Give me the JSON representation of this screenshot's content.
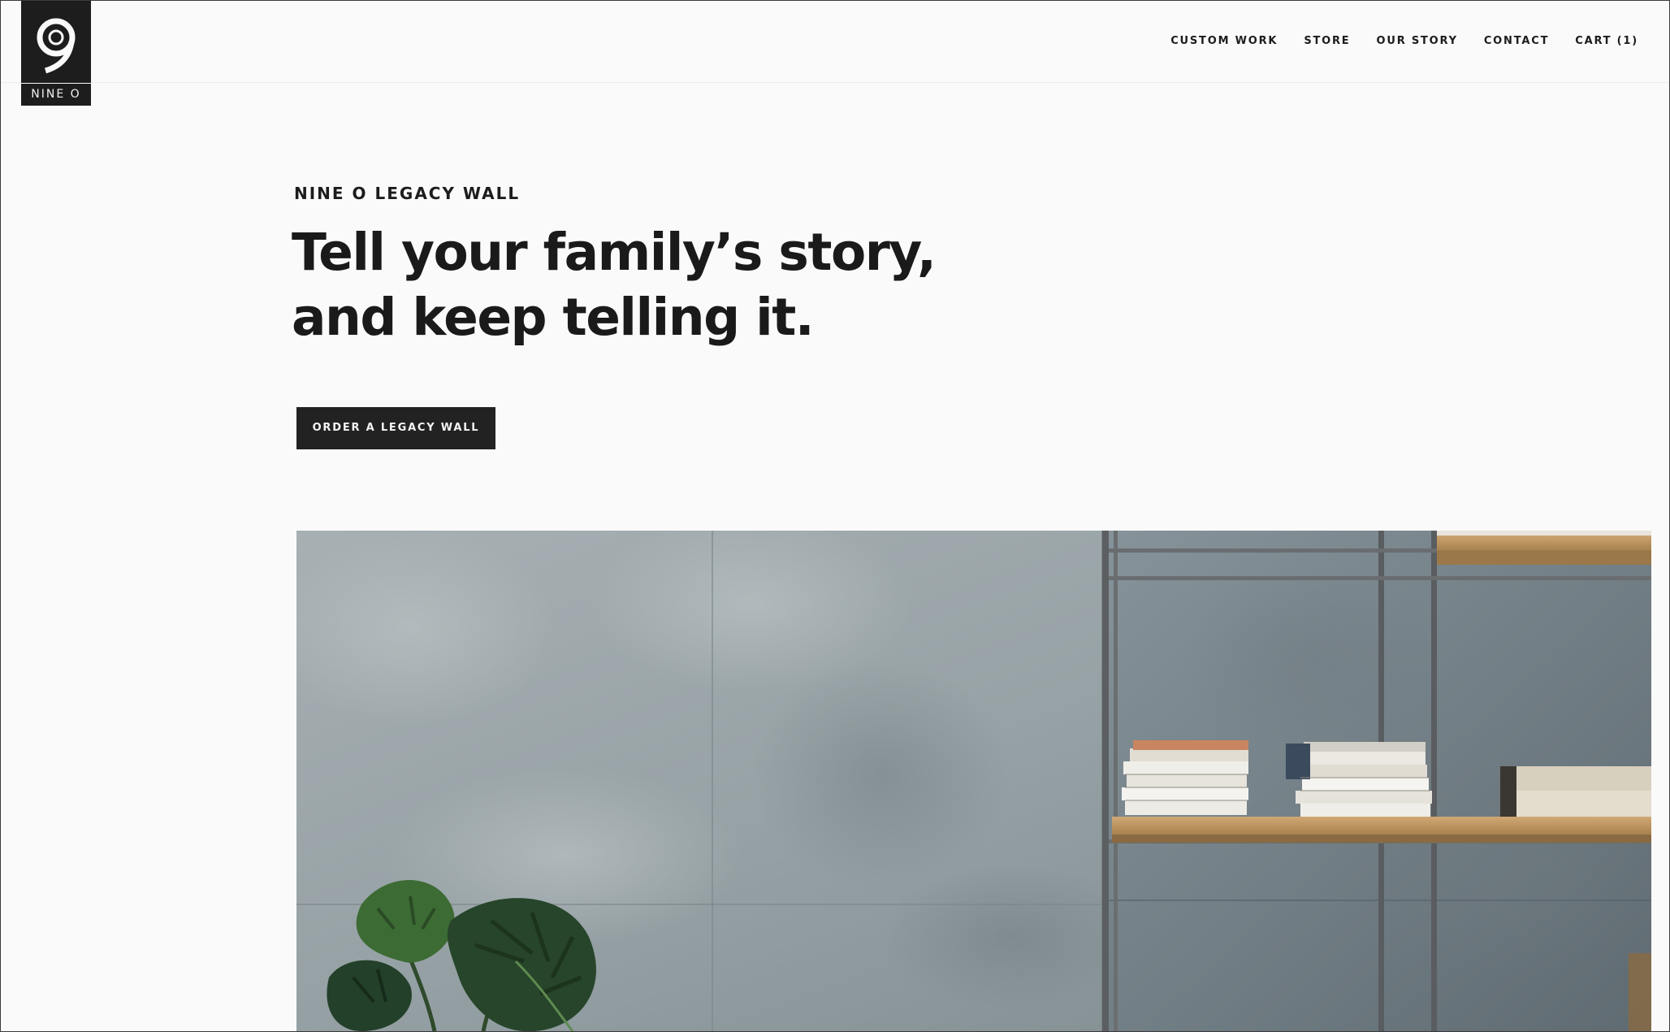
{
  "brand": {
    "logo_text": "NINE O",
    "logo_icon": "nine-numeral-logo-icon"
  },
  "nav": {
    "items": [
      {
        "label": "CUSTOM WORK"
      },
      {
        "label": "STORE"
      },
      {
        "label": "OUR STORY"
      },
      {
        "label": "CONTACT"
      },
      {
        "label": "CART (1)"
      }
    ]
  },
  "hero": {
    "eyebrow": "NINE O LEGACY WALL",
    "headline_line1": "Tell your family’s story,",
    "headline_line2": "and keep telling it.",
    "cta_label": "ORDER A LEGACY WALL",
    "image_description_icon": "concrete-wall-shelf-plant-photo"
  },
  "colors": {
    "background": "#fafafa",
    "text": "#1c1c1c",
    "logo_bg": "#1d1d1d",
    "button_bg": "#222222",
    "button_text": "#f5f5f5"
  }
}
